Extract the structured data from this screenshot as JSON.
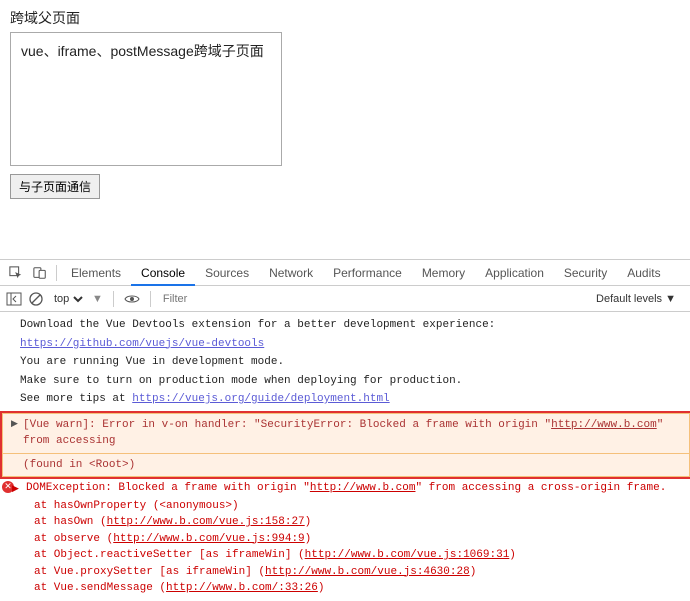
{
  "page": {
    "parent_title": "跨域父页面",
    "iframe_content": "vue、iframe、postMessage跨域子页面",
    "button_label": "与子页面通信"
  },
  "devtools": {
    "tabs": [
      "Elements",
      "Console",
      "Sources",
      "Network",
      "Performance",
      "Memory",
      "Application",
      "Security",
      "Audits"
    ],
    "active_tab": "Console",
    "context_selector": "top",
    "filter_placeholder": "Filter",
    "levels": "Default levels ▼"
  },
  "console": {
    "l1": "Download the Vue Devtools extension for a better development experience:",
    "l1_link": "https://github.com/vuejs/vue-devtools",
    "l2": "You are running Vue in development mode.",
    "l3": "Make sure to turn on production mode when deploying for production.",
    "l4a": "See more tips at ",
    "l4_link": "https://vuejs.org/guide/deployment.html",
    "warn_a": "[Vue warn]: Error in v-on handler: \"SecurityError: Blocked a frame with origin \"",
    "warn_link": "http://www.b.com",
    "warn_b": "\" from accessing",
    "warn_found": "(found in <Root>)",
    "err_a": "DOMException: Blocked a frame with origin \"",
    "err_link": "http://www.b.com",
    "err_b": "\" from accessing a cross-origin frame.",
    "stack": [
      {
        "pre": "at hasOwnProperty (<anonymous>)",
        "link": ""
      },
      {
        "pre": "at hasOwn (",
        "link": "http://www.b.com/vue.js:158:27",
        "post": ")"
      },
      {
        "pre": "at observe (",
        "link": "http://www.b.com/vue.js:994:9",
        "post": ")"
      },
      {
        "pre": "at Object.reactiveSetter [as iframeWin] (",
        "link": "http://www.b.com/vue.js:1069:31",
        "post": ")"
      },
      {
        "pre": "at Vue.proxySetter [as iframeWin] (",
        "link": "http://www.b.com/vue.js:4630:28",
        "post": ")"
      },
      {
        "pre": "at Vue.sendMessage (",
        "link": "http://www.b.com/:33:26",
        "post": ")"
      }
    ]
  }
}
